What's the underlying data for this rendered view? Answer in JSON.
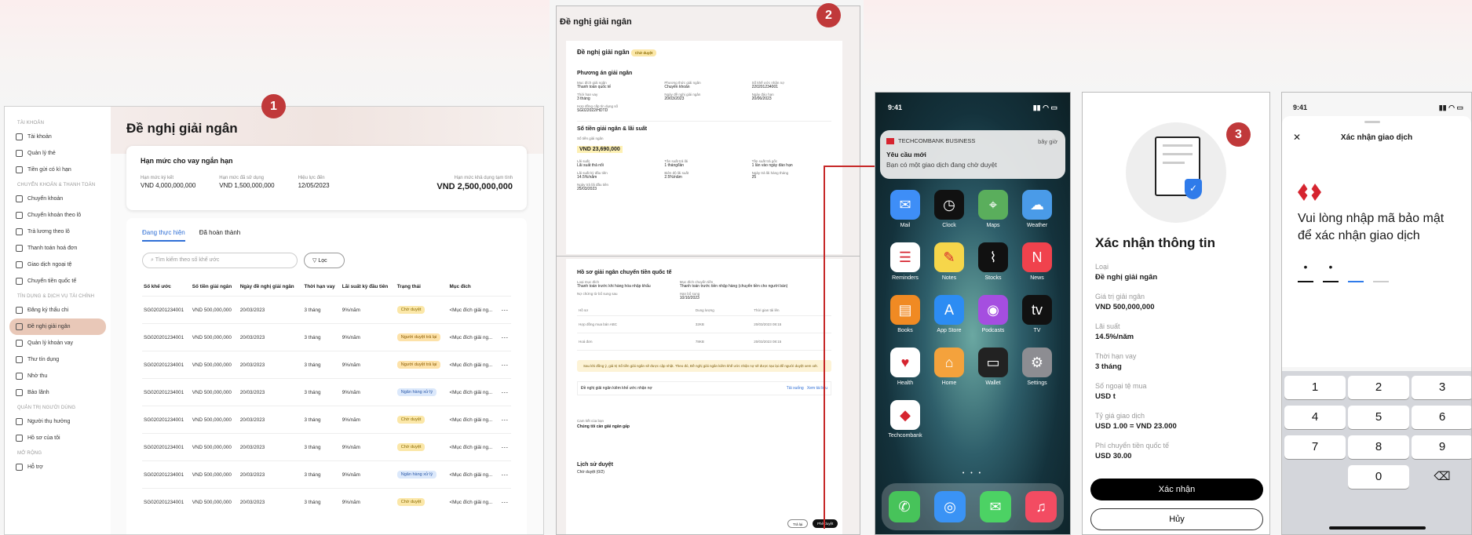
{
  "panel1": {
    "title": "Đề nghị giải ngân",
    "sidebar": {
      "sections": [
        {
          "label": "TÀI KHOẢN",
          "items": [
            {
              "label": "Tài khoản"
            },
            {
              "label": "Quản lý thẻ"
            },
            {
              "label": "Tiền gửi có kì hạn"
            }
          ]
        },
        {
          "label": "CHUYỂN KHOẢN & THANH TOÁN",
          "items": [
            {
              "label": "Chuyển khoản"
            },
            {
              "label": "Chuyển khoản theo lô"
            },
            {
              "label": "Trả lương theo lô"
            },
            {
              "label": "Thanh toán hoá đơn"
            },
            {
              "label": "Giao dịch ngoại tệ"
            },
            {
              "label": "Chuyển tiền quốc tế"
            }
          ]
        },
        {
          "label": "TÍN DỤNG & DỊCH VỤ TÀI CHÍNH",
          "items": [
            {
              "label": "Đăng ký thấu chi"
            },
            {
              "label": "Đề nghị giải ngân"
            },
            {
              "label": "Quản lý khoản vay"
            },
            {
              "label": "Thư tín dụng"
            },
            {
              "label": "Nhờ thu"
            },
            {
              "label": "Bảo lãnh"
            }
          ]
        },
        {
          "label": "QUẢN TRỊ NGƯỜI DÙNG",
          "items": [
            {
              "label": "Người thụ hưởng"
            },
            {
              "label": "Hồ sơ của tôi"
            }
          ]
        },
        {
          "label": "MỞ RỘNG",
          "items": [
            {
              "label": "Hỗ trợ"
            }
          ]
        }
      ]
    },
    "limit_card": {
      "title": "Hạn mức cho vay ngắn hạn",
      "fields": [
        {
          "k": "Hạn mức ký kết",
          "v": "VND 4,000,000,000"
        },
        {
          "k": "Hạn mức đã sử dụng",
          "v": "VND 1,500,000,000"
        },
        {
          "k": "Hiệu lực đến",
          "v": "12/05/2023"
        }
      ],
      "available_label": "Hạn mức khả dụng tạm tính",
      "available_value": "VND 2,500,000,000"
    },
    "tabs": [
      "Đang thực hiện",
      "Đã hoàn thành"
    ],
    "search_placeholder": "Tìm kiếm theo số khế ước",
    "filter_label": "Lọc",
    "columns": [
      "Số khế ước",
      "Số tiền giải ngân",
      "Ngày đề nghị giải ngân",
      "Thời hạn vay",
      "Lãi suất kỳ đầu tiên",
      "Trạng thái",
      "Mục đích"
    ],
    "rows": [
      {
        "id": "SG020201234001",
        "amt": "VND 500,000,000",
        "date": "20/03/2023",
        "term": "3 tháng",
        "rate": "9%/năm",
        "status": "Chờ duyệt",
        "purpose": "<Mục đích giải ng..."
      },
      {
        "id": "SG020201234001",
        "amt": "VND 500,000,000",
        "date": "20/03/2023",
        "term": "3 tháng",
        "rate": "9%/năm",
        "status": "Người duyệt trả lại",
        "purpose": "<Mục đích giải ng..."
      },
      {
        "id": "SG020201234001",
        "amt": "VND 500,000,000",
        "date": "20/03/2023",
        "term": "3 tháng",
        "rate": "9%/năm",
        "status": "Người duyệt trả lại",
        "purpose": "<Mục đích giải ng..."
      },
      {
        "id": "SG020201234001",
        "amt": "VND 500,000,000",
        "date": "20/03/2023",
        "term": "3 tháng",
        "rate": "9%/năm",
        "status": "Ngân hàng xử lý",
        "purpose": "<Mục đích giải ng..."
      },
      {
        "id": "SG020201234001",
        "amt": "VND 500,000,000",
        "date": "20/03/2023",
        "term": "3 tháng",
        "rate": "9%/năm",
        "status": "Chờ duyệt",
        "purpose": "<Mục đích giải ng..."
      },
      {
        "id": "SG020201234001",
        "amt": "VND 500,000,000",
        "date": "20/03/2023",
        "term": "3 tháng",
        "rate": "9%/năm",
        "status": "Chờ duyệt",
        "purpose": "<Mục đích giải ng..."
      },
      {
        "id": "SG020201234001",
        "amt": "VND 500,000,000",
        "date": "20/03/2023",
        "term": "3 tháng",
        "rate": "9%/năm",
        "status": "Ngân hàng xử lý",
        "purpose": "<Mục đích giải ng..."
      },
      {
        "id": "SG020201234001",
        "amt": "VND 500,000,000",
        "date": "20/03/2023",
        "term": "3 tháng",
        "rate": "9%/năm",
        "status": "Chờ duyệt",
        "purpose": "<Mục đích giải ng..."
      }
    ],
    "more_glyph": "⋯"
  },
  "panel2": {
    "page_title": "Đề nghị giải ngân",
    "card_title": "Đề nghị giải ngân",
    "badge": "Chờ duyệt",
    "section1": "Phương án giải ngân",
    "fields1": [
      {
        "k": "Mục đích giải ngân",
        "v": "Thanh toán quốc tế"
      },
      {
        "k": "Phương thức giải ngân",
        "v": "Chuyển khoản"
      },
      {
        "k": "Số khế ước nhận nợ",
        "v": "220201234001"
      },
      {
        "k": "Thời hạn vay",
        "v": "3 tháng"
      },
      {
        "k": "Ngày đề nghị giải ngân",
        "v": "20/03/2023"
      },
      {
        "k": "Ngày đáo hạn",
        "v": "20/06/2023"
      },
      {
        "k": "Hợp đồng cấp tín dụng số",
        "v": "SG022022/HDTD"
      }
    ],
    "section2": "Số tiền giải ngân & lãi suất",
    "amount_label": "Số tiền giải ngân",
    "amount_value": "VND 23,690,000",
    "fields2": [
      {
        "k": "Lãi suất",
        "v": "Lãi suất thả nổi"
      },
      {
        "k": "Tần suất trả lãi",
        "v": "1 tháng/lần"
      },
      {
        "k": "Tần suất trả gốc",
        "v": "1 lần vào ngày đáo hạn"
      },
      {
        "k": "Lãi suất kỳ đầu tiên",
        "v": "14.5%/năm"
      },
      {
        "k": "Biên độ lãi suất",
        "v": "2.5%/năm"
      },
      {
        "k": "Ngày trả lãi hàng tháng",
        "v": "25"
      },
      {
        "k": "Ngày trả lãi đầu tiên",
        "v": "25/03/2023"
      }
    ],
    "section3": "Hồ sơ giải ngân chuyển tiền quốc tế",
    "fields3": [
      {
        "k": "Loại mục đích",
        "v": "Thanh toán trước khi hàng hóa nhập khẩu"
      },
      {
        "k": "Mục đích chuyển tiền",
        "v": "Thanh toán trước tiền nhập hàng (chuyển tiền cho người bán)"
      },
      {
        "k": "Nợ chứng từ bổ sung sau",
        "v": ""
      },
      {
        "k": "Hạn bổ sung",
        "v": "10/10/2023"
      }
    ],
    "doc_headers": [
      "Hồ sơ",
      "Dung lượng",
      "Thời gian tải lên"
    ],
    "docs": [
      {
        "name": "Hợp đồng mua bán ABC",
        "size": "32KB",
        "time": "20/03/2023 08:15"
      },
      {
        "name": "Hoá đơn",
        "size": "78KB",
        "time": "20/03/2023 08:15"
      }
    ],
    "warning": "Sau khi đồng ý, giá trị Số tiền giải ngân sẽ được cập nhật. Theo đó, Đề nghị giải ngân kiêm khế ước nhận nợ sẽ được tạo lại để người duyệt xem xét.",
    "file_name": "Đề nghị giải ngân kiêm khế ước nhận nợ",
    "download": "Tải xuống",
    "view": "Xem tài liệu",
    "commit_label": "Cam kết của bạn",
    "commit_title": "Chúng tôi cần giải ngân gấp",
    "history": "Lịch sử duyệt",
    "history_item": "Chờ duyệt (0/2)",
    "btn_return": "Trả lại",
    "btn_approve": "Phê duyệt"
  },
  "panel3": {
    "time": "9:41",
    "notif_app": "TECHCOMBANK BUSINESS",
    "notif_time": "bây giờ",
    "notif_title": "Yêu cầu mới",
    "notif_body": "Bạn có một giao dịch đang chờ duyệt",
    "apps": [
      {
        "label": "Mail",
        "icon": "mail-icon",
        "color": "#3e8ef7",
        "glyph": "✉"
      },
      {
        "label": "Clock",
        "icon": "clock-icon",
        "color": "#111111",
        "glyph": "◷"
      },
      {
        "label": "Maps",
        "icon": "maps-icon",
        "color": "#5aae5c",
        "glyph": "⌖"
      },
      {
        "label": "Weather",
        "icon": "weather-icon",
        "color": "#4a9be8",
        "glyph": "☁"
      },
      {
        "label": "Reminders",
        "icon": "reminders-icon",
        "color": "#ffffff",
        "glyph": "☰"
      },
      {
        "label": "Notes",
        "icon": "notes-icon",
        "color": "#f6d64a",
        "glyph": "✎"
      },
      {
        "label": "Stocks",
        "icon": "stocks-icon",
        "color": "#111111",
        "glyph": "⌇"
      },
      {
        "label": "News",
        "icon": "news-icon",
        "color": "#f0424d",
        "glyph": "N"
      },
      {
        "label": "Books",
        "icon": "books-icon",
        "color": "#f08a23",
        "glyph": "▤"
      },
      {
        "label": "App Store",
        "icon": "app-store-icon",
        "color": "#2c8cf3",
        "glyph": "A"
      },
      {
        "label": "Podcasts",
        "icon": "podcasts-icon",
        "color": "#a54ee0",
        "glyph": "◉"
      },
      {
        "label": "TV",
        "icon": "tv-icon",
        "color": "#111111",
        "glyph": "tv"
      },
      {
        "label": "Health",
        "icon": "health-icon",
        "color": "#ffffff",
        "glyph": "♥"
      },
      {
        "label": "Home",
        "icon": "home-icon",
        "color": "#f4a23c",
        "glyph": "⌂"
      },
      {
        "label": "Wallet",
        "icon": "wallet-icon",
        "color": "#222222",
        "glyph": "▭"
      },
      {
        "label": "Settings",
        "icon": "settings-icon",
        "color": "#8d8d92",
        "glyph": "⚙"
      },
      {
        "label": "Techcombank",
        "icon": "techcombank-icon",
        "color": "#ffffff",
        "glyph": "◆"
      }
    ],
    "dots": "• • •",
    "dock": [
      {
        "icon": "phone-icon",
        "color": "#47c35a",
        "glyph": "✆"
      },
      {
        "icon": "safari-icon",
        "color": "#3a93f5",
        "glyph": "◎"
      },
      {
        "icon": "messages-icon",
        "color": "#4cd264",
        "glyph": "✉"
      },
      {
        "icon": "music-icon",
        "color": "#f34c62",
        "glyph": "♫"
      }
    ]
  },
  "panel4": {
    "title": "Xác nhận thông tin",
    "fields": [
      {
        "k": "Loại",
        "v": "Đề nghị giải ngân"
      },
      {
        "k": "Giá trị giải ngân",
        "v": "VND 500,000,000"
      },
      {
        "k": "Lãi suất",
        "v": "14.5%/năm"
      },
      {
        "k": "Thời hạn vay",
        "v": "3 tháng"
      },
      {
        "k": "Số ngoại tệ mua",
        "v": "USD t"
      },
      {
        "k": "Tỷ giá giao dịch",
        "v": "USD 1.00 = VND 23.000"
      },
      {
        "k": "Phí chuyển tiền quốc tế",
        "v": "USD 30.00"
      }
    ],
    "confirm": "Xác nhận",
    "cancel": "Hủy"
  },
  "panel5": {
    "time": "9:41",
    "title": "Xác nhận giao dịch",
    "close": "✕",
    "prompt": "Vui lòng nhập mã bảo mật để xác nhận giao dịch",
    "pin_dot": "•",
    "keys": [
      "1",
      "2",
      "3",
      "4",
      "5",
      "6",
      "7",
      "8",
      "9",
      "0"
    ],
    "backspace": "⌫"
  },
  "steps": [
    "1",
    "2",
    "3"
  ],
  "colors": {
    "accent": "#c0393a",
    "link": "#2f6fd6",
    "brand_red": "#d6242f"
  }
}
